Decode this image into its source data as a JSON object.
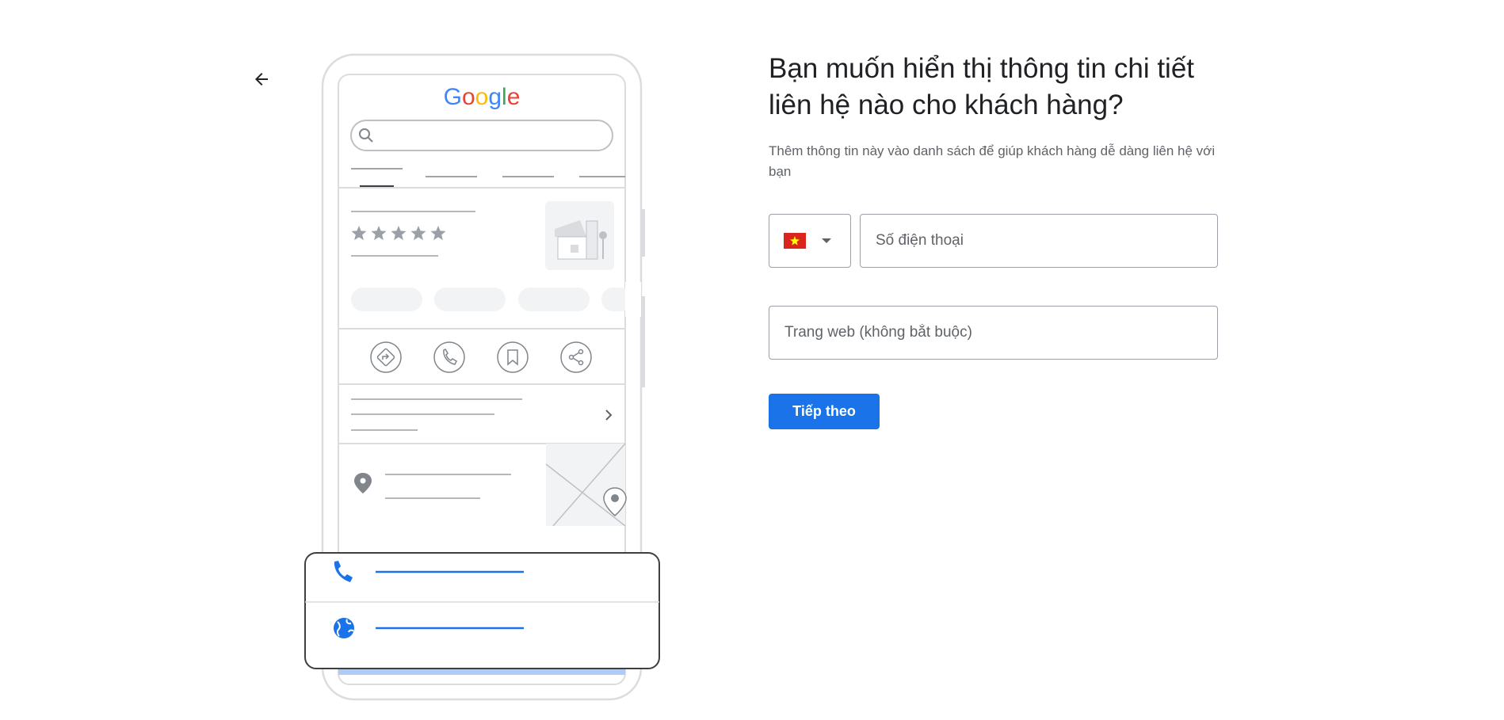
{
  "nav": {
    "back_icon": "arrow-left-icon"
  },
  "illustration": {
    "brand": "Google",
    "brand_colors": [
      "#4285F4",
      "#EA4335",
      "#FBBC05",
      "#4285F4",
      "#34A853",
      "#EA4335"
    ],
    "rating_stars": 5,
    "action_icons": [
      "directions-icon",
      "phone-icon",
      "bookmark-icon",
      "share-icon"
    ],
    "info_icons": [
      "location-pin-icon",
      "phone-icon",
      "globe-icon"
    ]
  },
  "form": {
    "title": "Bạn muốn hiển thị thông tin chi tiết liên hệ nào cho khách hàng?",
    "subtitle": "Thêm thông tin này vào danh sách để giúp khách hàng dễ dàng liên hệ với bạn",
    "country": {
      "flag": "vietnam-flag-icon",
      "flag_color": "#DA251D",
      "star_color": "#FFFF00"
    },
    "phone_placeholder": "Số điện thoại",
    "website_placeholder": "Trang web (không bắt buộc)",
    "next_label": "Tiếp theo",
    "accent_color": "#1A73E8"
  }
}
